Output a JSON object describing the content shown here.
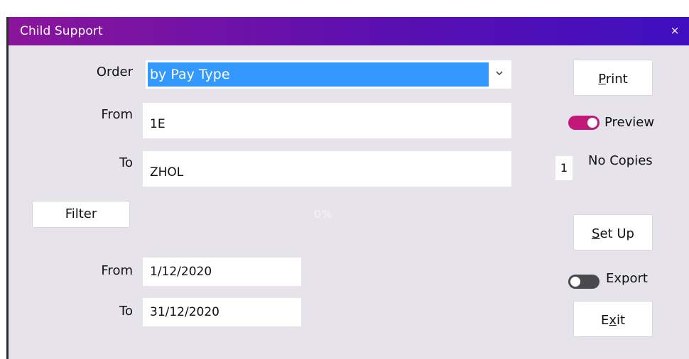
{
  "window": {
    "title": "Child Support",
    "close_glyph": "×"
  },
  "order": {
    "label": "Order",
    "selected": "by Pay Type"
  },
  "range": {
    "from_label": "From",
    "from_value": "1E",
    "to_label": "To",
    "to_value": "ZHOL"
  },
  "filter": {
    "label": "Filter"
  },
  "progress": {
    "text": "0%"
  },
  "dates": {
    "from_label": "From",
    "from_value": "1/12/2020",
    "to_label": "To",
    "to_value": "31/12/2020"
  },
  "side": {
    "print": {
      "pre": "",
      "accel": "P",
      "post": "rint"
    },
    "preview": {
      "label": "Preview",
      "on": true
    },
    "copies": {
      "value": "1",
      "label": "No Copies"
    },
    "setup": {
      "pre": "",
      "accel": "S",
      "post": "et Up"
    },
    "export": {
      "label": "Export",
      "on": false
    },
    "exit": {
      "pre": "E",
      "accel": "x",
      "post": "it"
    }
  },
  "colors": {
    "title_start": "#8a159b",
    "title_end": "#3f0fc0",
    "toggle_on": "#c2187a",
    "selection": "#3399ff"
  }
}
